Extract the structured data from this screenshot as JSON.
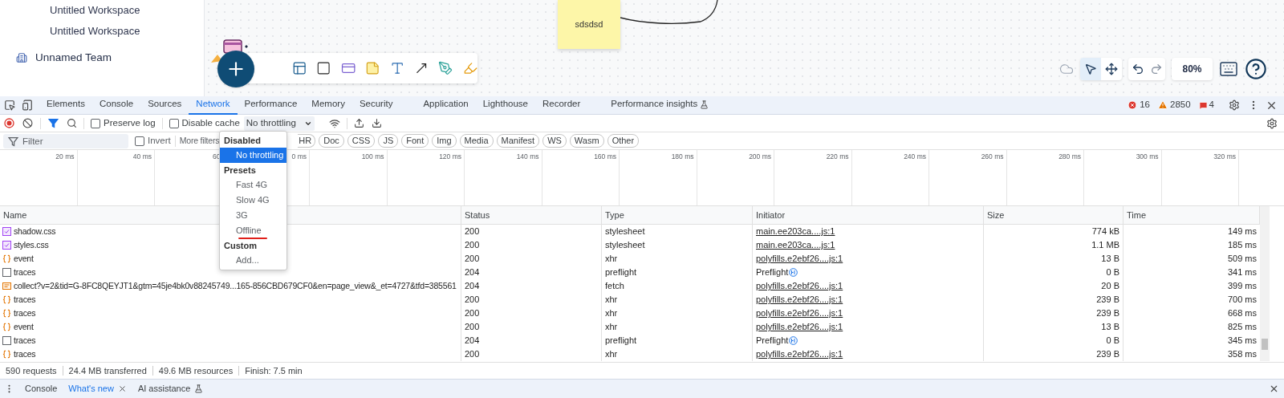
{
  "sidebar": {
    "items": [
      {
        "label": "Untitled Workspace",
        "kind": "workspace"
      },
      {
        "label": "Untitled Workspace",
        "kind": "workspace"
      },
      {
        "label": "Unnamed Team",
        "kind": "team"
      }
    ]
  },
  "canvas": {
    "sticky_note": "sdsdsd",
    "zoom": "80%"
  },
  "devtools": {
    "tabs": [
      {
        "label": "Elements",
        "selected": false,
        "experimental": false
      },
      {
        "label": "Console",
        "selected": false,
        "experimental": false
      },
      {
        "label": "Sources",
        "selected": false,
        "experimental": false
      },
      {
        "label": "Network",
        "selected": true,
        "experimental": false
      },
      {
        "label": "Performance",
        "selected": false,
        "experimental": false
      },
      {
        "label": "Memory",
        "selected": false,
        "experimental": false
      },
      {
        "label": "Security",
        "selected": false,
        "experimental": false
      },
      {
        "label": "Application",
        "selected": false,
        "experimental": false
      },
      {
        "label": "Lighthouse",
        "selected": false,
        "experimental": false
      },
      {
        "label": "Recorder",
        "selected": false,
        "experimental": false
      },
      {
        "label": "Performance insights",
        "selected": false,
        "experimental": true
      }
    ],
    "counts": {
      "errors": "16",
      "warnings": "2850",
      "issues": "4"
    },
    "toolbar": {
      "filter_on": true,
      "preserve_log": {
        "label": "Preserve log",
        "checked": false
      },
      "disable_cache": {
        "label": "Disable cache",
        "checked": false
      },
      "throttling": "No throttling"
    },
    "filter": {
      "placeholder": "Filter",
      "invert": {
        "label": "Invert",
        "checked": false
      },
      "more_filters": "More filters",
      "chips": [
        {
          "label": "HR",
          "cut": true
        },
        {
          "label": "Doc",
          "cut": false
        },
        {
          "label": "CSS",
          "cut": false
        },
        {
          "label": "JS",
          "cut": false
        },
        {
          "label": "Font",
          "cut": false
        },
        {
          "label": "Img",
          "cut": false
        },
        {
          "label": "Media",
          "cut": false
        },
        {
          "label": "Manifest",
          "cut": false
        },
        {
          "label": "WS",
          "cut": false
        },
        {
          "label": "Wasm",
          "cut": false
        },
        {
          "label": "Other",
          "cut": false
        }
      ]
    },
    "timeline": {
      "ticks": [
        {
          "label": "20 ms",
          "cut": false
        },
        {
          "label": "40 ms",
          "cut": false
        },
        {
          "label": "60",
          "cut": true
        },
        {
          "label": "0 ms",
          "cut": false
        },
        {
          "label": "100 ms",
          "cut": false
        },
        {
          "label": "120 ms",
          "cut": false
        },
        {
          "label": "140 ms",
          "cut": false
        },
        {
          "label": "160 ms",
          "cut": false
        },
        {
          "label": "180 ms",
          "cut": false
        },
        {
          "label": "200 ms",
          "cut": false
        },
        {
          "label": "220 ms",
          "cut": false
        },
        {
          "label": "240 ms",
          "cut": false
        },
        {
          "label": "260 ms",
          "cut": false
        },
        {
          "label": "280 ms",
          "cut": false
        },
        {
          "label": "300 ms",
          "cut": false
        },
        {
          "label": "320 ms",
          "cut": false
        }
      ]
    },
    "throttling_menu": {
      "groups": [
        {
          "heading": "Disabled",
          "options": [
            {
              "label": "No throttling",
              "selected": true,
              "underlined": false
            }
          ]
        },
        {
          "heading": "Presets",
          "options": [
            {
              "label": "Fast 4G",
              "selected": false,
              "underlined": false
            },
            {
              "label": "Slow 4G",
              "selected": false,
              "underlined": false
            },
            {
              "label": "3G",
              "selected": false,
              "underlined": false
            },
            {
              "label": "Offline",
              "selected": false,
              "underlined": true
            }
          ]
        },
        {
          "heading": "Custom",
          "options": [
            {
              "label": "Add...",
              "selected": false,
              "underlined": false
            }
          ]
        }
      ]
    },
    "table": {
      "columns": [
        "Name",
        "Status",
        "Type",
        "Initiator",
        "Size",
        "Time"
      ],
      "rows": [
        {
          "kind": "css",
          "name": "shadow.css",
          "status": "200",
          "type": "stylesheet",
          "initiator": "main.ee203ca....js:1",
          "initiator_link": true,
          "size": "774 kB",
          "time": "149 ms"
        },
        {
          "kind": "css",
          "name": "styles.css",
          "status": "200",
          "type": "stylesheet",
          "initiator": "main.ee203ca....js:1",
          "initiator_link": true,
          "size": "1.1 MB",
          "time": "185 ms"
        },
        {
          "kind": "xhr",
          "name": "event",
          "status": "200",
          "type": "xhr",
          "initiator": "polyfills.e2ebf26....js:1",
          "initiator_link": true,
          "size": "13 B",
          "time": "509 ms"
        },
        {
          "kind": "preflight",
          "name": "traces",
          "status": "204",
          "type": "preflight",
          "initiator": "Preflight",
          "initiator_link": false,
          "size": "0 B",
          "time": "341 ms"
        },
        {
          "kind": "fetch",
          "name": "collect?v=2&tid=G-8FC8QEYJT1&gtm=45je4bk0v88245749...165-856CBD679CF0&en=page_view&_et=4727&tfd=385561",
          "status": "204",
          "type": "fetch",
          "initiator": "polyfills.e2ebf26....js:1",
          "initiator_link": true,
          "size": "20 B",
          "time": "399 ms"
        },
        {
          "kind": "xhr",
          "name": "traces",
          "status": "200",
          "type": "xhr",
          "initiator": "polyfills.e2ebf26....js:1",
          "initiator_link": true,
          "size": "239 B",
          "time": "700 ms"
        },
        {
          "kind": "xhr",
          "name": "traces",
          "status": "200",
          "type": "xhr",
          "initiator": "polyfills.e2ebf26....js:1",
          "initiator_link": true,
          "size": "239 B",
          "time": "668 ms"
        },
        {
          "kind": "xhr",
          "name": "event",
          "status": "200",
          "type": "xhr",
          "initiator": "polyfills.e2ebf26....js:1",
          "initiator_link": true,
          "size": "13 B",
          "time": "825 ms"
        },
        {
          "kind": "preflight",
          "name": "traces",
          "status": "204",
          "type": "preflight",
          "initiator": "Preflight",
          "initiator_link": false,
          "size": "0 B",
          "time": "345 ms"
        },
        {
          "kind": "xhr",
          "name": "traces",
          "status": "200",
          "type": "xhr",
          "initiator": "polyfills.e2ebf26....js:1",
          "initiator_link": true,
          "size": "239 B",
          "time": "358 ms"
        }
      ]
    },
    "status_bar": [
      "590 requests",
      "24.4 MB transferred",
      "49.6 MB resources",
      "Finish: 7.5 min"
    ],
    "drawer": {
      "tabs": [
        {
          "label": "Console",
          "selected": false,
          "closable": false,
          "experimental": false
        },
        {
          "label": "What's new",
          "selected": true,
          "closable": true,
          "experimental": false
        },
        {
          "label": "AI assistance",
          "selected": false,
          "closable": false,
          "experimental": true
        }
      ]
    }
  }
}
